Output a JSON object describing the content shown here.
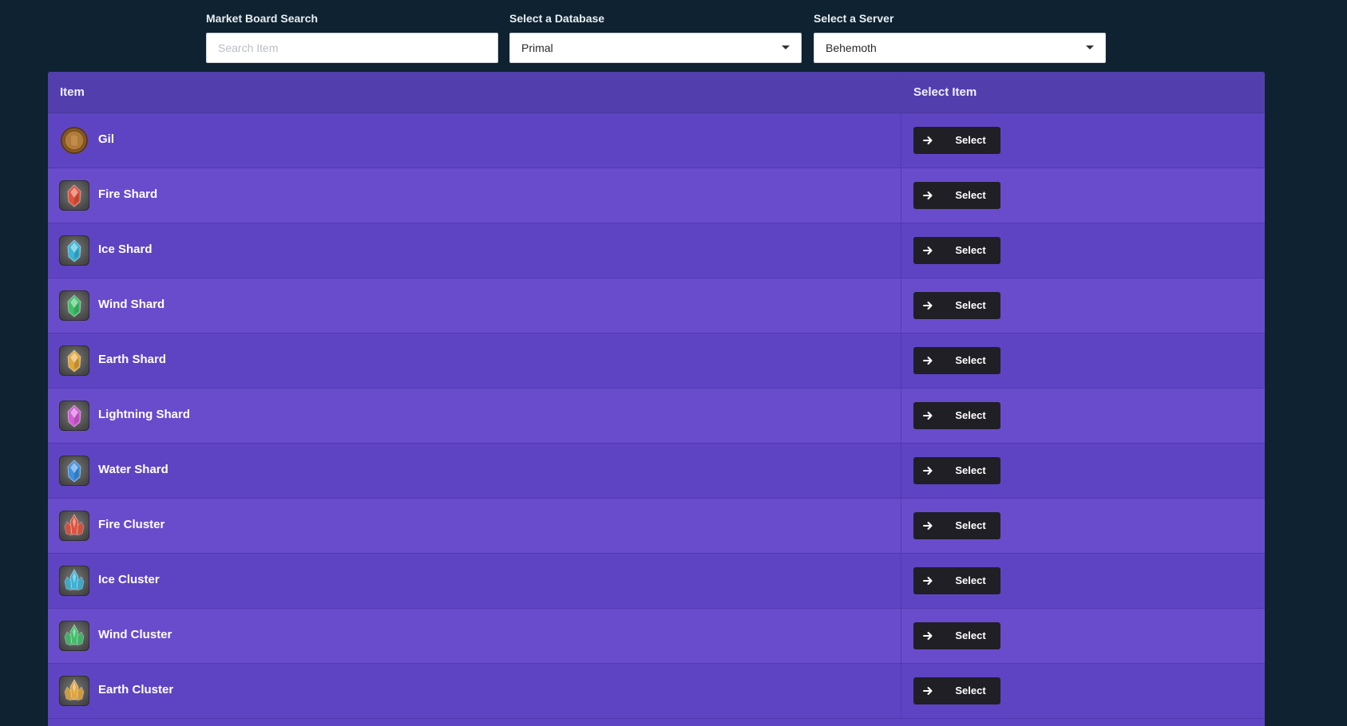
{
  "controls": {
    "search": {
      "label": "Market Board Search",
      "placeholder": "Search Item",
      "value": ""
    },
    "database": {
      "label": "Select a Database",
      "value": "Primal"
    },
    "server": {
      "label": "Select a Server",
      "value": "Behemoth"
    }
  },
  "table": {
    "headers": {
      "item": "Item",
      "select": "Select Item"
    },
    "button_label": "Select",
    "rows": [
      {
        "name": "Gil",
        "icon": "gil-coin-icon",
        "color": "#b07a3a"
      },
      {
        "name": "Fire Shard",
        "icon": "fire-shard-icon",
        "color": "#e0503a"
      },
      {
        "name": "Ice Shard",
        "icon": "ice-shard-icon",
        "color": "#39b4d8"
      },
      {
        "name": "Wind Shard",
        "icon": "wind-shard-icon",
        "color": "#3fbf6a"
      },
      {
        "name": "Earth Shard",
        "icon": "earth-shard-icon",
        "color": "#e0a53a"
      },
      {
        "name": "Lightning Shard",
        "icon": "lightning-shard-icon",
        "color": "#d35bd8"
      },
      {
        "name": "Water Shard",
        "icon": "water-shard-icon",
        "color": "#3d8fe0"
      },
      {
        "name": "Fire Cluster",
        "icon": "fire-cluster-icon",
        "color": "#e0503a"
      },
      {
        "name": "Ice Cluster",
        "icon": "ice-cluster-icon",
        "color": "#39b4d8"
      },
      {
        "name": "Wind Cluster",
        "icon": "wind-cluster-icon",
        "color": "#3fbf6a"
      },
      {
        "name": "Earth Cluster",
        "icon": "earth-cluster-icon",
        "color": "#e0a53a"
      }
    ]
  }
}
